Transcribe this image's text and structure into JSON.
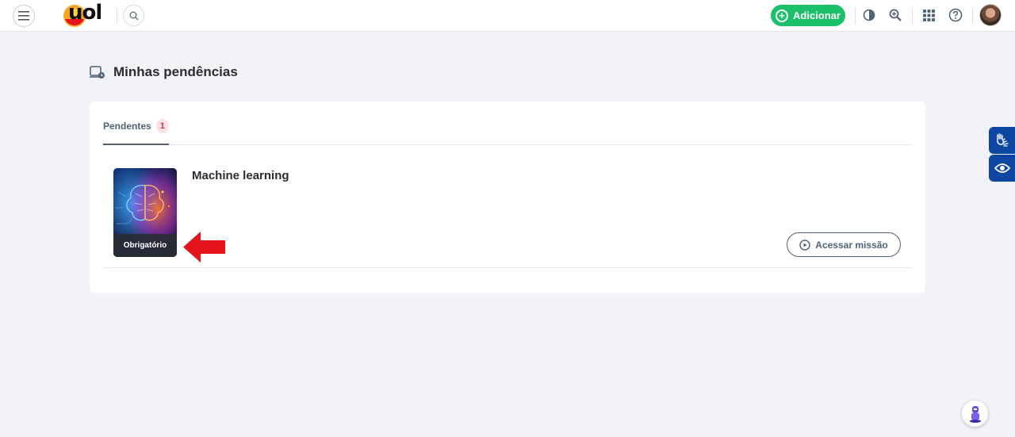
{
  "header": {
    "logo_text": "uol",
    "add_label": "Adicionar",
    "icons": [
      "menu-icon",
      "search-icon",
      "contrast-icon",
      "zoom-in-icon",
      "apps-grid-icon",
      "help-icon"
    ]
  },
  "page": {
    "title": "Minhas pendências"
  },
  "tabs": [
    {
      "label": "Pendentes",
      "count": "1"
    }
  ],
  "item": {
    "title": "Machine learning",
    "tag": "Obrigatório",
    "action_label": "Acessar missão"
  },
  "colors": {
    "accent_green": "#1bc06a",
    "tab_blue_gray": "#4f6377",
    "a11y_blue": "#0d47a1",
    "arrow_red": "#e5141b"
  }
}
